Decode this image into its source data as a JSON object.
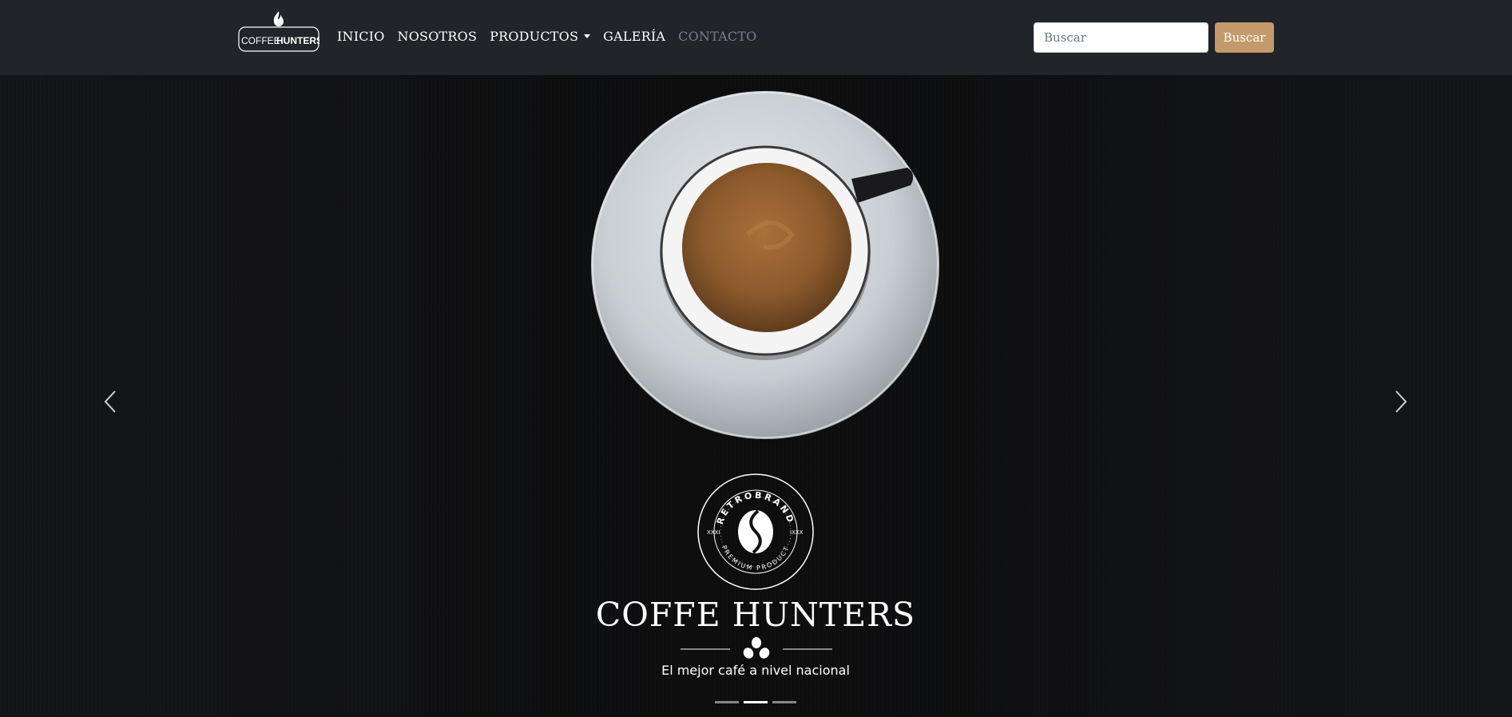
{
  "brand": {
    "logo_word1": "COFFEE",
    "logo_word2": "HUNTERS"
  },
  "nav": {
    "items": [
      {
        "label": "INICIO"
      },
      {
        "label": "NOSOTROS"
      },
      {
        "label": "PRODUCTOS"
      },
      {
        "label": "GALERÍA"
      },
      {
        "label": "CONTACTO"
      }
    ]
  },
  "search": {
    "placeholder": "Buscar",
    "value": "",
    "button_label": "Buscar"
  },
  "hero": {
    "emblem_top": "RETROBRAND",
    "emblem_bottom": "PREMIUM PRODUCT",
    "emblem_left": "XXXI",
    "emblem_right": "IXXX",
    "title": "COFFE HUNTERS",
    "subtitle": "El mejor café a nivel nacional"
  },
  "carousel": {
    "slide_count": 3,
    "active_slide": 2
  },
  "colors": {
    "navbar_bg": "#212429",
    "accent": "#c49a6c",
    "muted_link": "#7b7f85",
    "text": "#ffffff"
  },
  "icons": {
    "brand": "flame-logo-icon",
    "prev": "chevron-left-icon",
    "next": "chevron-right-icon",
    "divider": "coffee-beans-icon",
    "emblem": "coffee-bean-emblem-icon"
  }
}
